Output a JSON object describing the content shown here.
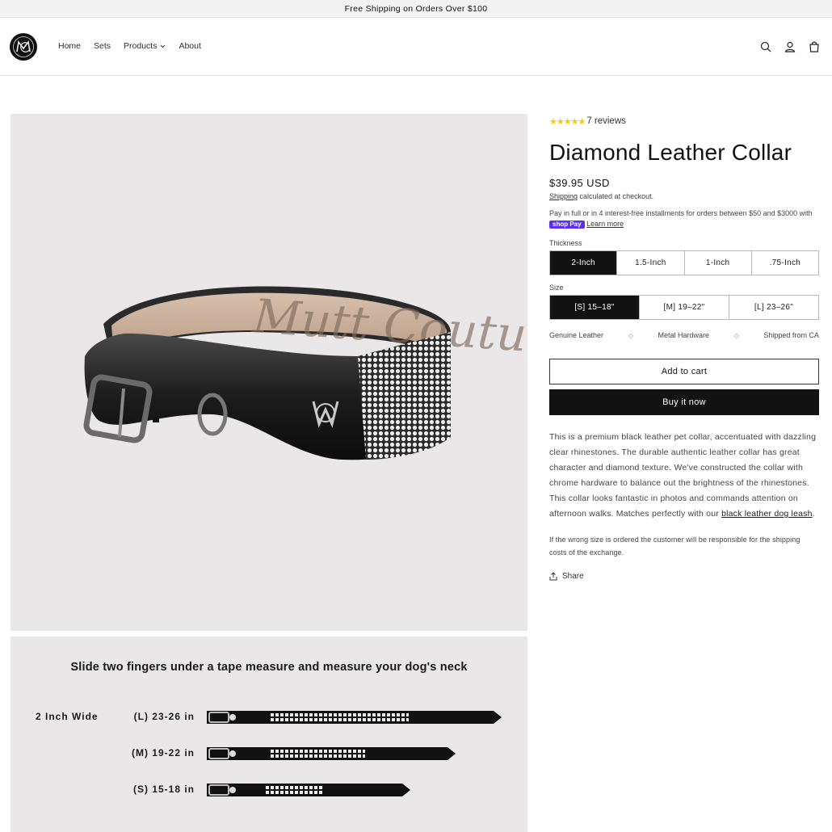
{
  "announcement": "Free Shipping on Orders Over $100",
  "nav": {
    "items": [
      {
        "label": "Home"
      },
      {
        "label": "Sets"
      },
      {
        "label": "Products"
      },
      {
        "label": "About"
      }
    ]
  },
  "header_icons": [
    "search-icon",
    "account-icon",
    "cart-icon"
  ],
  "product": {
    "rating_stars": "★★★★★",
    "reviews": "7 reviews",
    "title": "Diamond Leather Collar",
    "price": "$39.95 USD",
    "shipping_link": "Shipping",
    "shipping_text": " calculated at checkout.",
    "installments_text": "Pay in full or in 4 interest-free installments for orders between $50 and $3000 with ",
    "shoppay": "shop Pay",
    "learn_more": "Learn more",
    "thickness_label": "Thickness",
    "thickness_options": [
      "2-Inch",
      "1.5-Inch",
      "1-Inch",
      ".75-Inch"
    ],
    "thickness_selected": "2-Inch",
    "size_label": "Size",
    "size_options": [
      "[S] 15–18\"",
      "[M] 19–22\"",
      "[L] 23–26\""
    ],
    "size_selected": "[S] 15–18\"",
    "features": [
      "Genuine Leather",
      "Metal Hardware",
      "Shipped from CA"
    ],
    "add_to_cart": "Add to cart",
    "buy_now": "Buy it now",
    "description": "This is a premium black leather pet collar, accentuated with dazzling clear rhinestones. The durable authentic leather collar has great character and diamond texture. We've constructed the collar with chrome hardware to balance out the brightness of the rhinestones. This collar looks fantastic in photos and commands attention on afternoon walks. Matches perfectly with our ",
    "description_link": "black leather dog leash",
    "description_end": ".",
    "size_note": "If the wrong size is ordered the customer will be responsible for the shipping costs of the exchange.",
    "share": "Share"
  },
  "size_guide": {
    "title": "Slide two fingers under a tape measure and measure your dog's neck",
    "wide_label": "2 Inch Wide",
    "rows": [
      {
        "label": "(L)  23-26 in"
      },
      {
        "label": "(M)  19-22 in"
      },
      {
        "label": "(S)  15-18 in"
      }
    ]
  },
  "colors": {
    "accent": "#121212",
    "star": "#f5c518",
    "shoppay": "#5a31f4",
    "image_bg": "#eae7e8"
  }
}
